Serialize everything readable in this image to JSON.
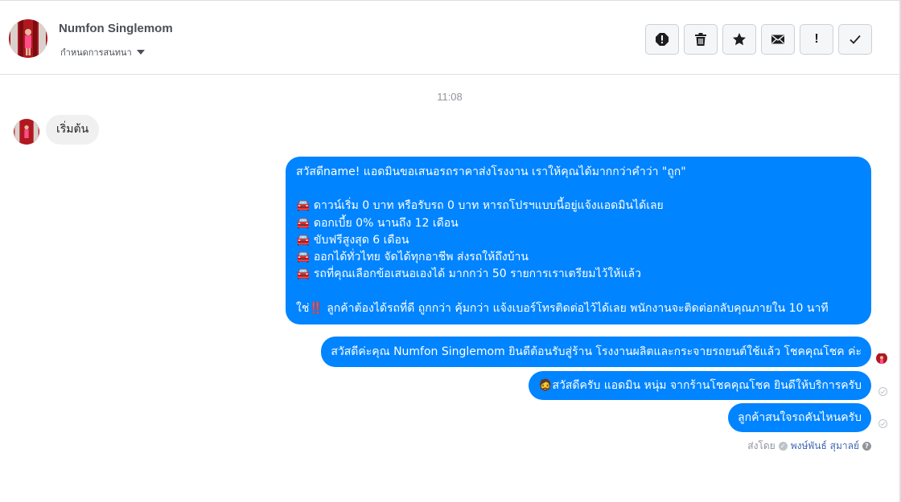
{
  "header": {
    "contact_name": "Numfon Singlemom",
    "label_dropdown": "กำหนดการสนทนา",
    "toolbar": [
      {
        "name": "spam-button",
        "icon": "alert-circle-icon"
      },
      {
        "name": "delete-button",
        "icon": "trash-icon"
      },
      {
        "name": "star-button",
        "icon": "star-icon"
      },
      {
        "name": "mark-unread-button",
        "icon": "envelope-icon"
      },
      {
        "name": "follow-up-button",
        "icon": "exclamation-icon",
        "label": "!"
      },
      {
        "name": "mark-done-button",
        "icon": "check-icon"
      }
    ]
  },
  "conversation": {
    "timestamp": "11:08",
    "incoming": {
      "text": "เริ่มต้น"
    },
    "outgoing": [
      {
        "text": "สวัสดีname! แอดมินขอเสนอรถราคาส่งโรงงาน เราให้คุณได้มากกว่าคำว่า \"ถูก\"\n\n🚘 ดาวน์เริ่ม 0 บาท หรือรับรถ 0 บาท หารถโปรฯแบบนี้อยู่แจ้งแอดมินได้เลย\n🚘 ดอกเบี้ย 0% นานถึง 12 เดือน\n🚘 ขับฟรีสูงสุด 6 เดือน\n🚘 ออกได้ทั่วไทย จัดได้ทุกอาชีพ ส่งรถให้ถึงบ้าน\n🚘 รถที่คุณเลือกข้อเสนอเองได้ มากกว่า 50 รายการเราเตรียมไว้ให้แล้ว\n\nใช่‼️ ลูกค้าต้องได้รถที่ดี ถูกกว่า คุ้มกว่า แจ้งเบอร์โทรติดต่อไว้ได้เลย พนักงานจะติดต่อกลับคุณภายใน 10 นาที"
      },
      {
        "text": "สวัสดีค่ะคุณ Numfon Singlemom ยินดีต้อนรับสู่ร้าน โรงงานผลิตและกระจายรถยนต์ใช้แล้ว โชคคุณโชค ค่ะ"
      },
      {
        "text": "🧔สวัสดีครับ แอดมิน หนุ่ม จากร้านโชคคุณโชค ยินดีให้บริการครับ"
      },
      {
        "text": "ลูกค้าสนใจรถคันไหนครับ"
      }
    ],
    "sent_by": {
      "prefix": "ส่งโดย",
      "name": "พงษ์พันธ์ สุมาลย์",
      "help": "?"
    }
  },
  "colors": {
    "outgoing_bubble": "#0084ff",
    "incoming_bubble": "#f1f0f0",
    "link": "#4267b2"
  }
}
